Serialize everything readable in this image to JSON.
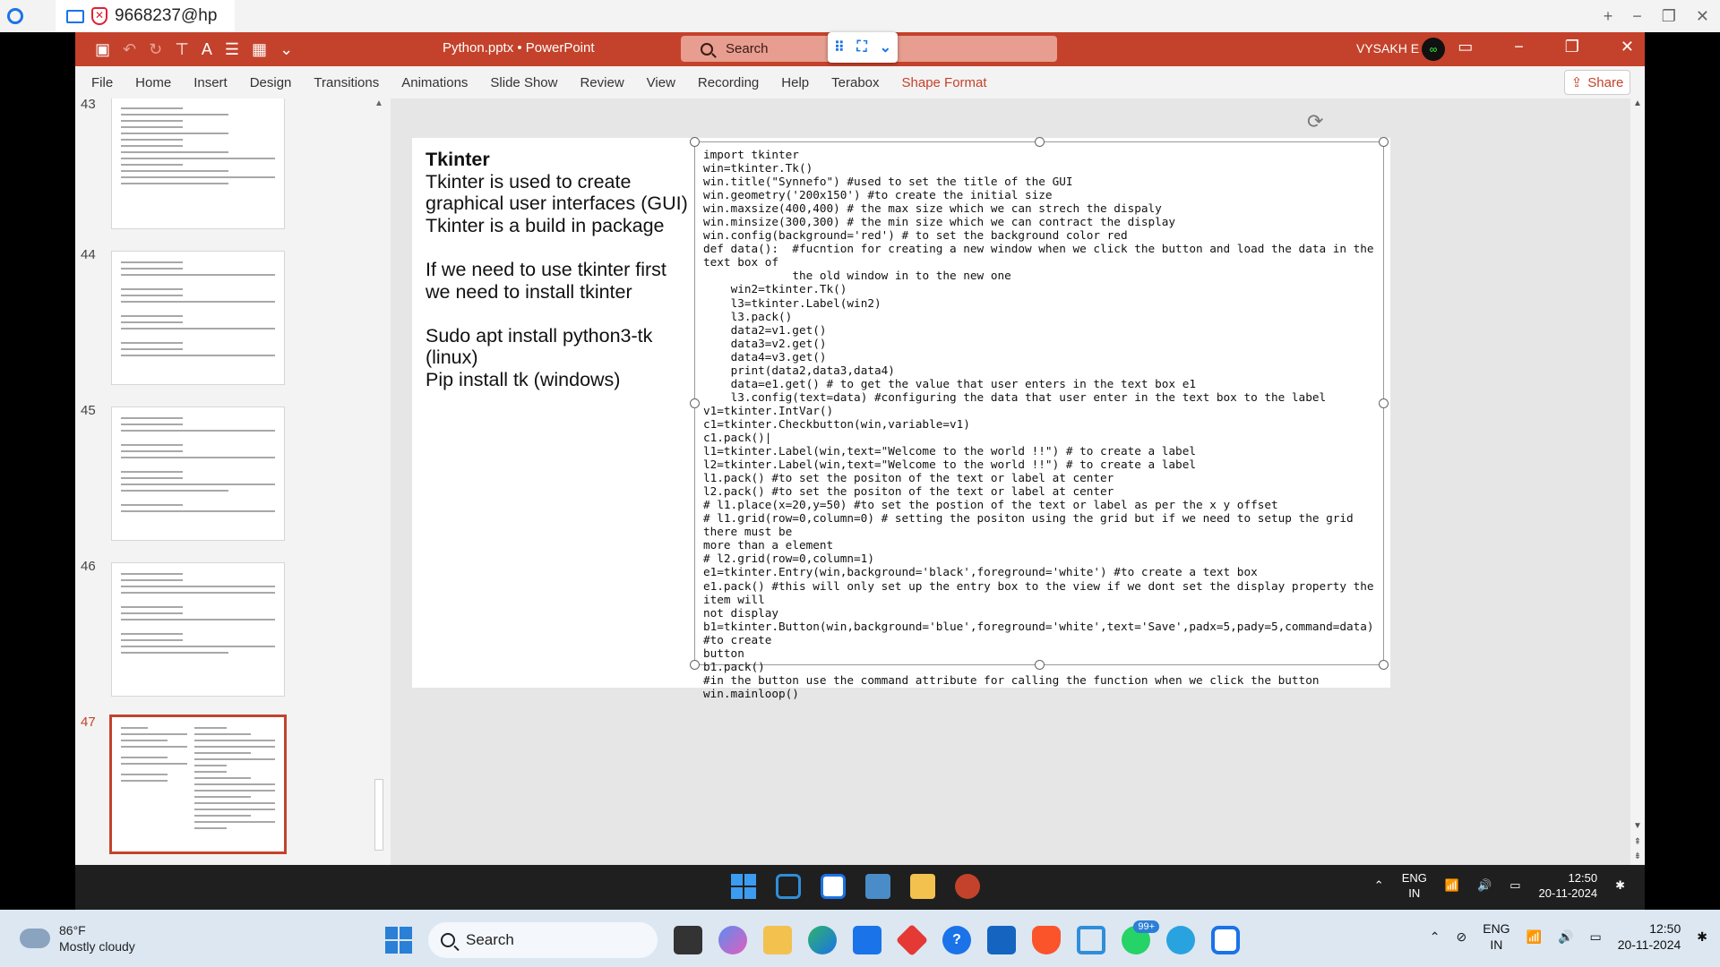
{
  "remote_bar": {
    "tab_title": "9668237@hp"
  },
  "window": {
    "doc_title": "Python.pptx  •  PowerPoint",
    "search_placeholder": "Search",
    "user_name": "VYSAKH E",
    "avatar_text": "∞"
  },
  "ribbon": {
    "tabs": [
      "File",
      "Home",
      "Insert",
      "Design",
      "Transitions",
      "Animations",
      "Slide Show",
      "Review",
      "View",
      "Recording",
      "Help",
      "Terabox",
      "Shape Format"
    ],
    "active_tab": "Shape Format",
    "share_label": "Share"
  },
  "thumbnails": {
    "numbers": [
      "43",
      "44",
      "45",
      "46",
      "47"
    ],
    "selected": "47"
  },
  "slide": {
    "heading": "Tkinter",
    "left_lines": [
      "Tkinter is used to create graphical user interfaces (GUI)",
      "Tkinter is a build in package",
      "",
      "If we need to use tkinter first we need to install tkinter",
      "",
      "Sudo apt install python3-tk (linux)",
      "Pip install tk (windows)"
    ],
    "code": "import tkinter\nwin=tkinter.Tk()\nwin.title(\"Synnefo\") #used to set the title of the GUI\nwin.geometry('200x150') #to create the initial size\nwin.maxsize(400,400) # the max size which we can strech the dispaly\nwin.minsize(300,300) # the min size which we can contract the display\nwin.config(background='red') # to set the background color red\ndef data():  #fucntion for creating a new window when we click the button and load the data in the text box of\n             the old window in to the new one\n    win2=tkinter.Tk()\n    l3=tkinter.Label(win2)\n    l3.pack()\n    data2=v1.get()\n    data3=v2.get()\n    data4=v3.get()\n    print(data2,data3,data4)\n    data=e1.get() # to get the value that user enters in the text box e1\n    l3.config(text=data) #configuring the data that user enter in the text box to the label\nv1=tkinter.IntVar()\nc1=tkinter.Checkbutton(win,variable=v1)\nc1.pack()|\nl1=tkinter.Label(win,text=\"Welcome to the world !!\") # to create a label\nl2=tkinter.Label(win,text=\"Welcome to the world !!\") # to create a label\nl1.pack() #to set the positon of the text or label at center\nl2.pack() #to set the positon of the text or label at center\n# l1.place(x=20,y=50) #to set the postion of the text or label as per the x y offset\n# l1.grid(row=0,column=0) # setting the positon using the grid but if we need to setup the grid there must be\nmore than a element\n# l2.grid(row=0,column=1)\ne1=tkinter.Entry(win,background='black',foreground='white') #to create a text box\ne1.pack() #this will only set up the entry box to the view if we dont set the display property the item will\nnot display\nb1=tkinter.Button(win,background='blue',foreground='white',text='Save',padx=5,pady=5,command=data) #to create\nbutton\nb1.pack()\n#in the button use the command attribute for calling the function when we click the button\nwin.mainloop()"
  },
  "inner_taskbar": {
    "lang_top": "ENG",
    "lang_bottom": "IN",
    "time": "12:50",
    "date": "20-11-2024"
  },
  "taskbar": {
    "temperature": "86°F",
    "condition": "Mostly cloudy",
    "search_placeholder": "Search",
    "badge": "99+",
    "lang_top": "ENG",
    "lang_bottom": "IN",
    "time": "12:50",
    "date": "20-11-2024"
  },
  "colors": {
    "accent": "#c4422b"
  }
}
